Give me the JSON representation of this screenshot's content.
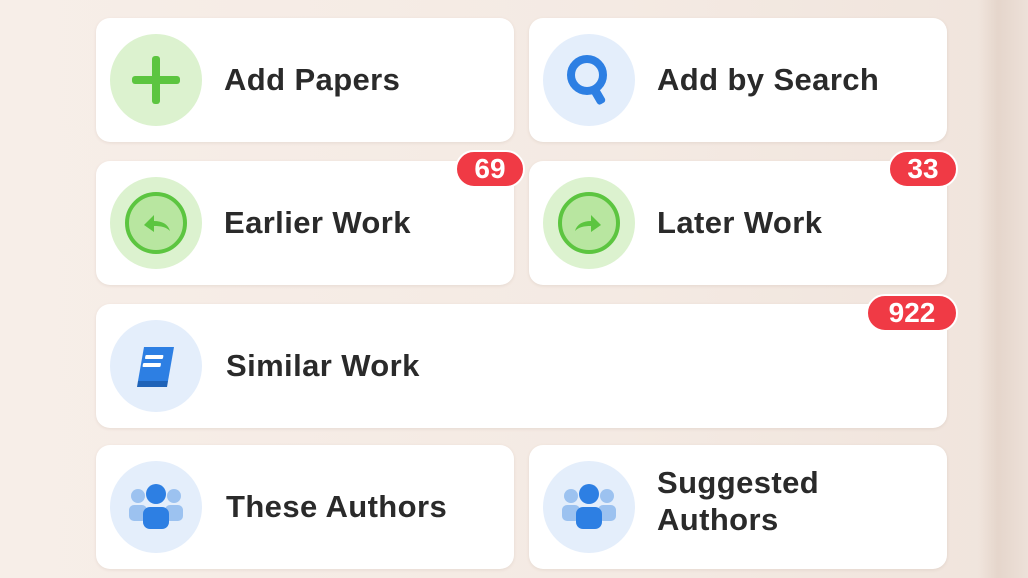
{
  "tiles": {
    "add_papers": {
      "label": "Add Papers",
      "icon": "plus-icon"
    },
    "add_by_search": {
      "label": "Add by Search",
      "icon": "search-icon"
    },
    "earlier_work": {
      "label": "Earlier Work",
      "icon": "arrow-back-icon",
      "badge": "69"
    },
    "later_work": {
      "label": "Later Work",
      "icon": "arrow-forward-icon",
      "badge": "33"
    },
    "similar_work": {
      "label": "Similar Work",
      "icon": "book-icon",
      "badge": "922"
    },
    "these_authors": {
      "label": "These Authors",
      "icon": "authors-icon"
    },
    "suggested_authors": {
      "label_line1": "Suggested",
      "label_line2": "Authors",
      "icon": "authors-icon"
    }
  },
  "colors": {
    "badge": "#f03a45",
    "green_icon": "#5cc540",
    "green_circle": "#dcf2cf",
    "blue_icon": "#2d7fe3",
    "blue_circle": "#e4eefb"
  }
}
